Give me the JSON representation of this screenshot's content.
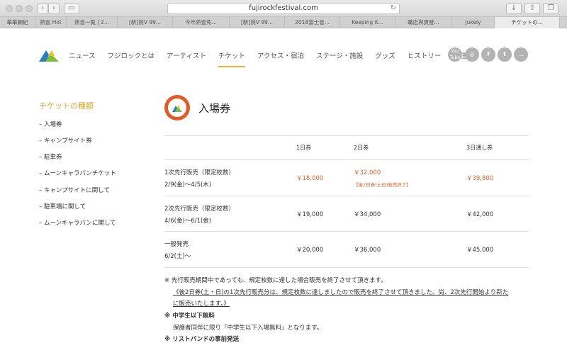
{
  "browser": {
    "url": "fujirockfestival.com",
    "tabs": [
      "華華網紀",
      "熱音 Hot ",
      "熱音一覧 | 2...",
      "[新]熱V 99...",
      "今年熱音免...",
      "[新]熱V 99...",
      "2018富士音...",
      "Keeping it...",
      "職店與頁發...",
      "Jukely",
      "チケットの..."
    ]
  },
  "nav": {
    "items": [
      "ニュース",
      "フジロックとは",
      "アーティスト",
      "チケット",
      "アクセス・宿泊",
      "ステージ・施設",
      "グッズ",
      "ヒストリー",
      "ご注意"
    ],
    "active_index": 3
  },
  "social": [
    "You Tube",
    "◎",
    "f",
    "t",
    "…"
  ],
  "sidebar": {
    "title": "チケットの種類",
    "items": [
      "– 入場券",
      "– キャンプサイト券",
      "– 駐車券",
      "– ムーンキャラバンチケット",
      "– キャンプサイトに関して",
      "– 駐車場に関して",
      "– ムーンキャラバンに関して"
    ]
  },
  "main": {
    "title": "入場券",
    "columns": [
      "1日券",
      "2日券",
      "3日通し券"
    ],
    "rows": [
      {
        "label1": "1次先行販売（限定枚数）",
        "label2": "2/9(金)～4/5(木)",
        "p1": "￥18,000",
        "p2": "￥32,000",
        "p3": "￥39,800",
        "note": "【後2日券(土日)販売終了】"
      },
      {
        "label1": "2次先行販売（限定枚数）",
        "label2": "4/6(金)～6/1(金)",
        "p1": "￥19,000",
        "p2": "￥34,000",
        "p3": "￥42,000"
      },
      {
        "label1": "一般発売",
        "label2": "6/2(土)～",
        "p1": "￥20,000",
        "p2": "￥36,000",
        "p3": "￥45,000"
      }
    ],
    "notes": {
      "n1": "※ 先行販売期間中であっても、規定枚数に達した場合販売を終了させて頂きます。",
      "n2": "《後2日券(土・日)の1次先行販売分は、規定枚数に達しましたので販売を終了させて頂きました。尚、2次先行開始より新た",
      "n3": "に販売いたします。》",
      "n4": "※ 中学生以下無料",
      "n5": "保護者同伴に限り「中学生以下入場無料」となります。",
      "n6": "※ リストバンドの事前発送"
    }
  },
  "colors": {
    "accent": "#f0b030",
    "price": "#e0602e"
  }
}
